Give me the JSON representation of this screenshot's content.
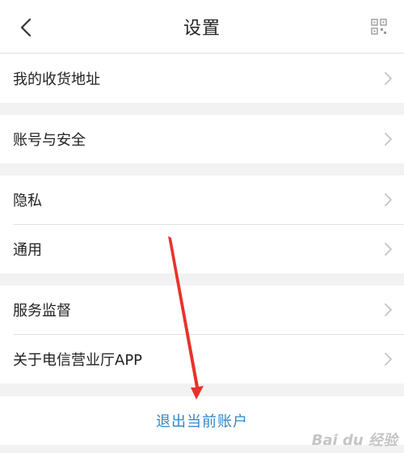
{
  "header": {
    "title": "设置",
    "back_icon": "chevron-left-icon",
    "qr_icon": "qr-code-icon"
  },
  "groups": [
    {
      "items": [
        {
          "label": "我的收货地址"
        }
      ]
    },
    {
      "items": [
        {
          "label": "账号与安全"
        }
      ]
    },
    {
      "items": [
        {
          "label": "隐私"
        },
        {
          "label": "通用"
        }
      ]
    },
    {
      "items": [
        {
          "label": "服务监督"
        },
        {
          "label": "关于电信营业厅APP"
        }
      ]
    }
  ],
  "logout": {
    "label": "退出当前账户"
  },
  "watermark": {
    "text": "Bai du 经验"
  },
  "colors": {
    "accent": "#2f86c9",
    "annotation": "#e8322b",
    "background": "#f2f2f2"
  }
}
